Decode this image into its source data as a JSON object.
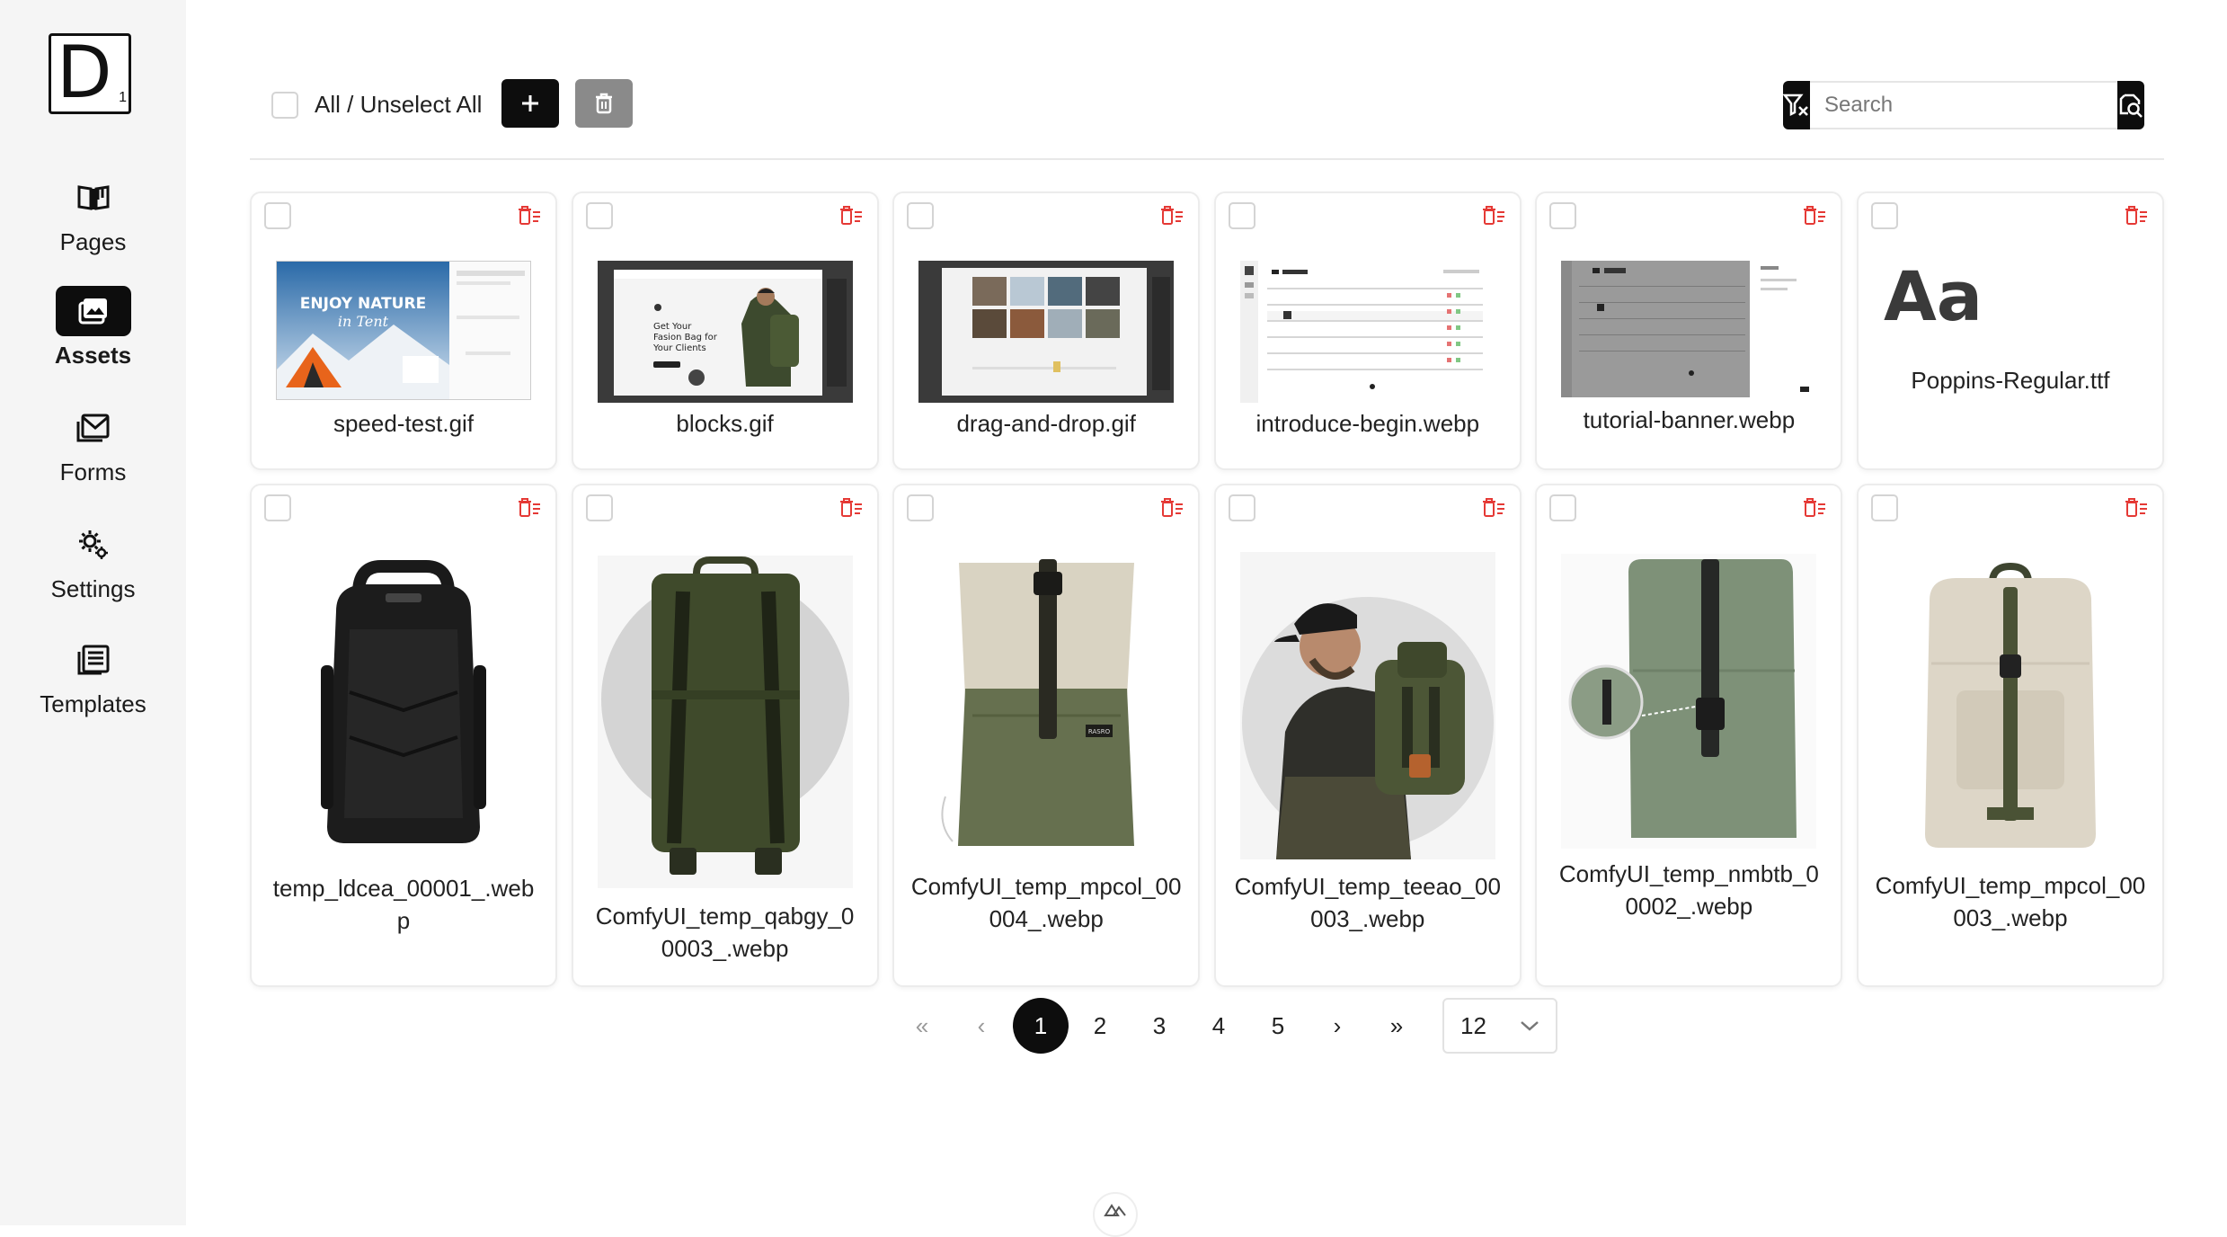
{
  "sidebar": {
    "logo": {
      "letter": "D",
      "sub": "1"
    },
    "items": [
      {
        "label": "Pages",
        "icon": "book-open-icon",
        "active": false
      },
      {
        "label": "Assets",
        "icon": "image-icon",
        "active": true
      },
      {
        "label": "Forms",
        "icon": "mail-icon",
        "active": false
      },
      {
        "label": "Settings",
        "icon": "gear-icon",
        "active": false
      },
      {
        "label": "Templates",
        "icon": "list-document-icon",
        "active": false
      }
    ]
  },
  "toolbar": {
    "select_all_label": "All / Unselect All",
    "add_icon": "plus-icon",
    "delete_icon": "trash-icon",
    "filter_clear_icon": "filter-clear-icon",
    "search_placeholder": "Search",
    "search_value": "",
    "search_icon": "search-document-icon"
  },
  "assets": [
    {
      "name": "speed-test.gif",
      "kind": "screenshot-tent"
    },
    {
      "name": "blocks.gif",
      "kind": "screenshot-bag"
    },
    {
      "name": "drag-and-drop.gif",
      "kind": "screenshot-gallery"
    },
    {
      "name": "introduce-begin.webp",
      "kind": "screenshot-table"
    },
    {
      "name": "tutorial-banner.webp",
      "kind": "screenshot-gray"
    },
    {
      "name": "Poppins-Regular.ttf",
      "kind": "font",
      "preview": "Aa"
    },
    {
      "name": "temp_ldcea_00001_.webp",
      "kind": "backpack-black"
    },
    {
      "name": "ComfyUI_temp_qabgy_00003_.webp",
      "kind": "backpack-olive-back"
    },
    {
      "name": "ComfyUI_temp_mpcol_00004_.webp",
      "kind": "backpack-beige-green"
    },
    {
      "name": "ComfyUI_temp_teeao_00003_.webp",
      "kind": "backpack-man"
    },
    {
      "name": "ComfyUI_temp_nmbtb_00002_.webp",
      "kind": "backpack-green-rolltop"
    },
    {
      "name": "ComfyUI_temp_mpcol_00003_.webp",
      "kind": "backpack-beige"
    }
  ],
  "thumb_text": {
    "tent_line1": "ENJOY NATURE",
    "tent_line2": "in Tent",
    "bag_line1": "Get Your",
    "bag_line2": "Fasion Bag for",
    "bag_line3": "Your Clients",
    "backpack_tag": "RASRO"
  },
  "pagination": {
    "first": "«",
    "prev": "‹",
    "pages": [
      "1",
      "2",
      "3",
      "4",
      "5"
    ],
    "current": "1",
    "next": "›",
    "last": "»",
    "per_page": "12"
  },
  "colors": {
    "sidebar_bg": "#f5f5f5",
    "primary": "#0d0d0d",
    "danger": "#e53935",
    "muted_button": "#8a8a8a"
  }
}
